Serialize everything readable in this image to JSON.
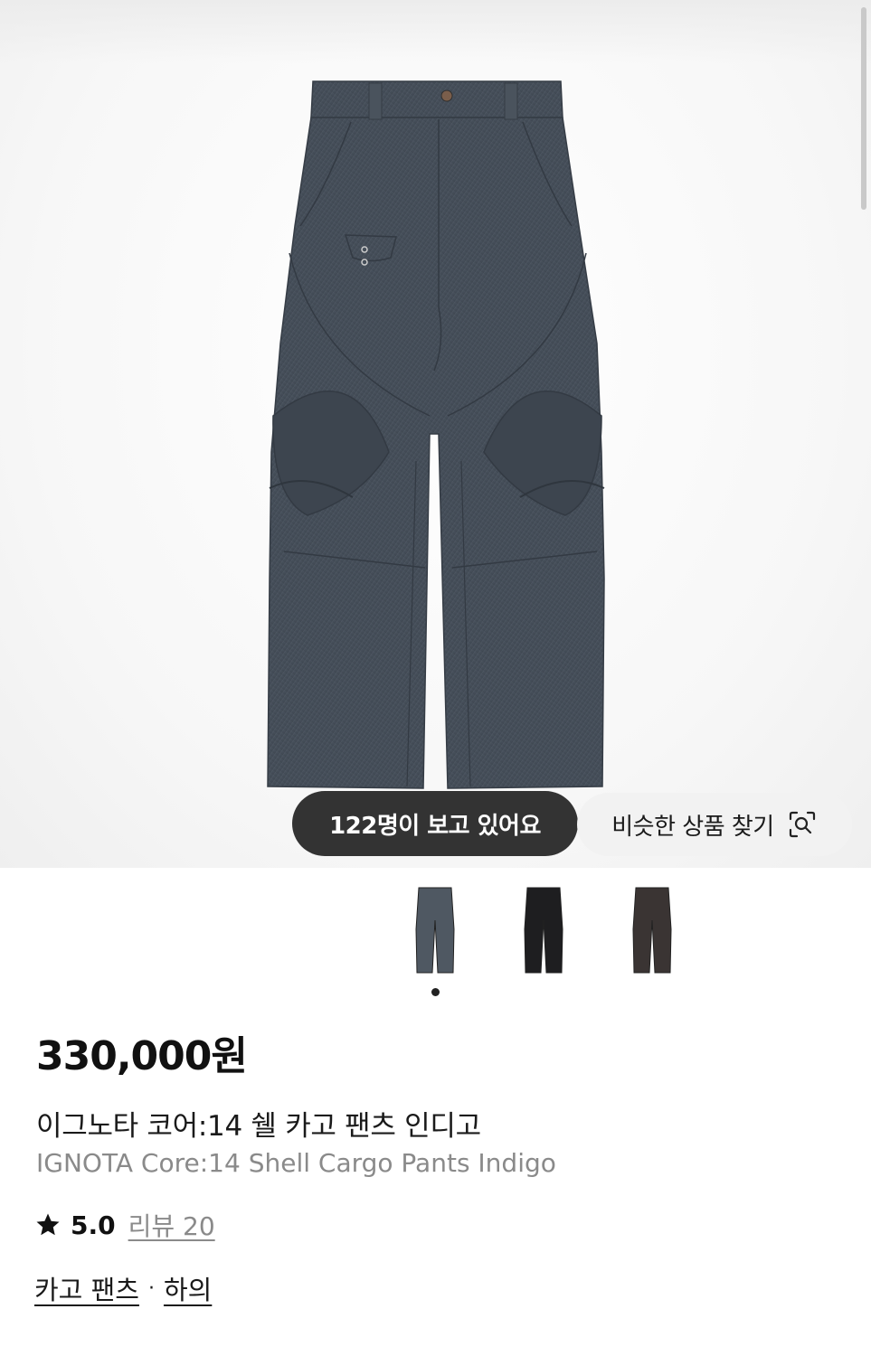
{
  "gallery": {
    "viewers_badge": "122명이 보고 있어요",
    "similar_button": "비슷한 상품 찾기",
    "similar_icon": "visual-search-icon",
    "thumbnails": [
      {
        "color_name": "indigo",
        "color": "#4f5862"
      },
      {
        "color_name": "black",
        "color": "#1e1e20"
      },
      {
        "color_name": "brown",
        "color": "#3a3433"
      }
    ],
    "active_index": 0
  },
  "product": {
    "price": "330,000원",
    "name_ko": "이그노타 코어:14 쉘 카고 팬츠 인디고",
    "name_en": "IGNOTA Core:14 Shell Cargo Pants Indigo",
    "rating": "5.0",
    "rating_icon": "star-icon",
    "review_link": "리뷰 20",
    "categories": [
      "카고 팬츠",
      "하의"
    ],
    "category_separator": "·"
  }
}
